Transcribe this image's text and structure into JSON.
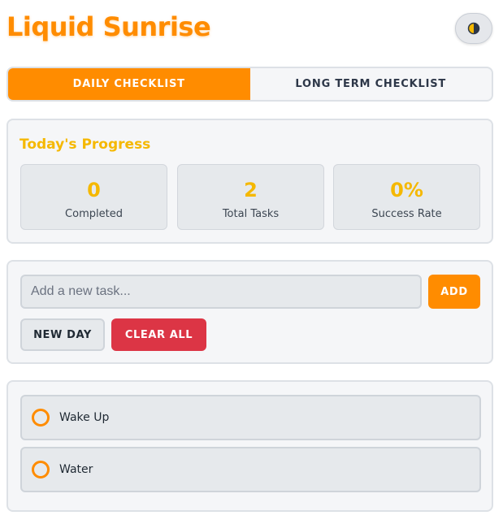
{
  "header": {
    "title": "Liquid Sunrise",
    "theme_toggle_icon": "half-moon-icon"
  },
  "tabs": [
    {
      "label": "DAILY CHECKLIST",
      "active": true
    },
    {
      "label": "LONG TERM CHECKLIST",
      "active": false
    }
  ],
  "progress": {
    "title": "Today's Progress",
    "stats": [
      {
        "value": "0",
        "label": "Completed"
      },
      {
        "value": "2",
        "label": "Total Tasks"
      },
      {
        "value": "0%",
        "label": "Success Rate"
      }
    ]
  },
  "task_entry": {
    "input_value": "",
    "placeholder": "Add a new task...",
    "add_label": "ADD",
    "new_day_label": "NEW DAY",
    "clear_all_label": "CLEAR ALL"
  },
  "tasks": [
    {
      "text": "Wake Up",
      "done": false
    },
    {
      "text": "Water",
      "done": false
    }
  ],
  "colors": {
    "accent": "#ff8c00",
    "highlight": "#f5b800",
    "danger": "#dc3545",
    "card_bg": "#f5f6f8"
  }
}
